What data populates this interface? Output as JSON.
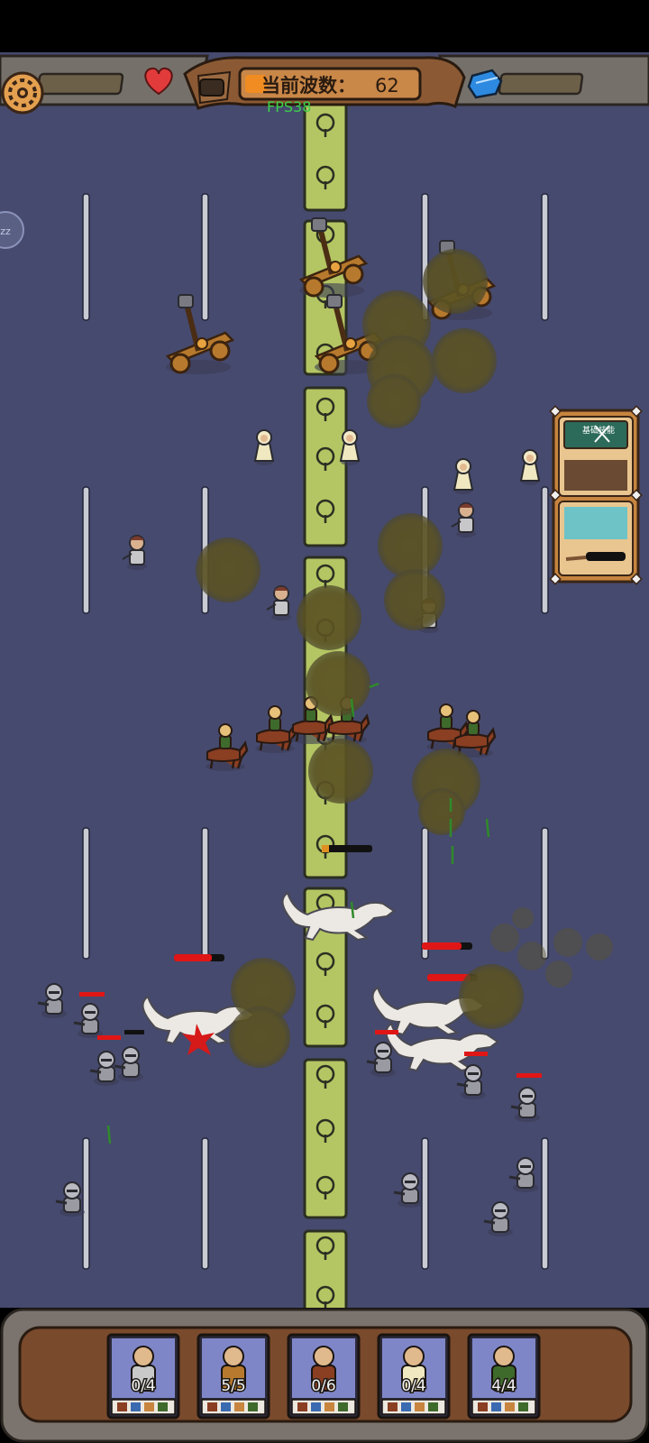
{
  "hud": {
    "wave_label": "当前波数：",
    "wave_number": "62",
    "fps": "FPS38",
    "side_button": "zz",
    "skill_panel_label": "基础技能"
  },
  "icons": {
    "settings": "gear-icon",
    "health": "heart-icon",
    "resource": "blue-gem-icon"
  },
  "colors": {
    "battlefield": "#464a6e",
    "median": "#b4c563",
    "hud_wood": "#7a4a2c",
    "fps": "#3cd24a",
    "health_bar": "#e01616"
  },
  "units": [
    {
      "name": "gunner",
      "count": "0/4"
    },
    {
      "name": "catapult",
      "count": "5/5"
    },
    {
      "name": "cavalry",
      "count": "0/6"
    },
    {
      "name": "priestess",
      "count": "0/4"
    },
    {
      "name": "elf-archer",
      "count": "4/4"
    }
  ]
}
